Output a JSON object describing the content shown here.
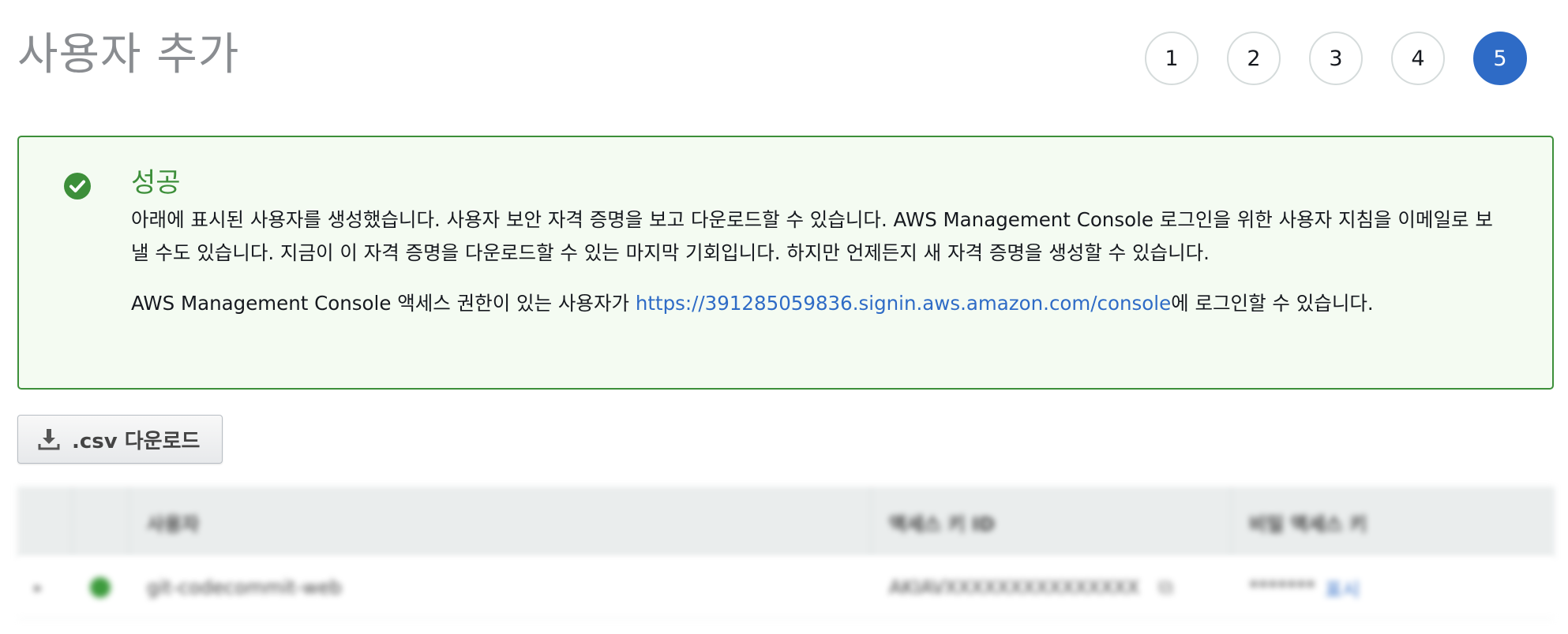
{
  "page": {
    "title": "사용자 추가",
    "steps": [
      "1",
      "2",
      "3",
      "4",
      "5"
    ],
    "active_step": "5"
  },
  "alert": {
    "title": "성공",
    "line1": "아래에 표시된 사용자를 생성했습니다. 사용자 보안 자격 증명을 보고 다운로드할 수 있습니다. AWS Management Console 로그인을 위한 사용자 지침을 이메일로 보낼 수도 있습니다. 지금이 이 자격 증명을 다운로드할 수 있는 마지막 기회입니다. 하지만 언제든지 새 자격 증명을 생성할 수 있습니다.",
    "line2_prefix": "AWS Management Console 액세스 권한이 있는 사용자가 ",
    "link": "https://391285059836.signin.aws.amazon.com/console",
    "line2_suffix": "에 로그인할 수 있습니다.",
    "icon": "check-circle-icon",
    "color": "#3d8f3a"
  },
  "toolbar": {
    "download_label": ".csv 다운로드",
    "download_icon": "download-icon"
  },
  "table": {
    "headers": [
      "",
      "",
      "사용자",
      "액세스 키 ID",
      "비밀 액세스 키"
    ],
    "rows": [
      {
        "expand": "▸",
        "user": "git-codecommit-web",
        "access_key": "AKIAVXXXXXXXXXXXXXXX",
        "secret": "*******",
        "show_label": "표시"
      }
    ]
  },
  "colors": {
    "accent": "#2e6bc6",
    "success": "#3d8f3a"
  }
}
